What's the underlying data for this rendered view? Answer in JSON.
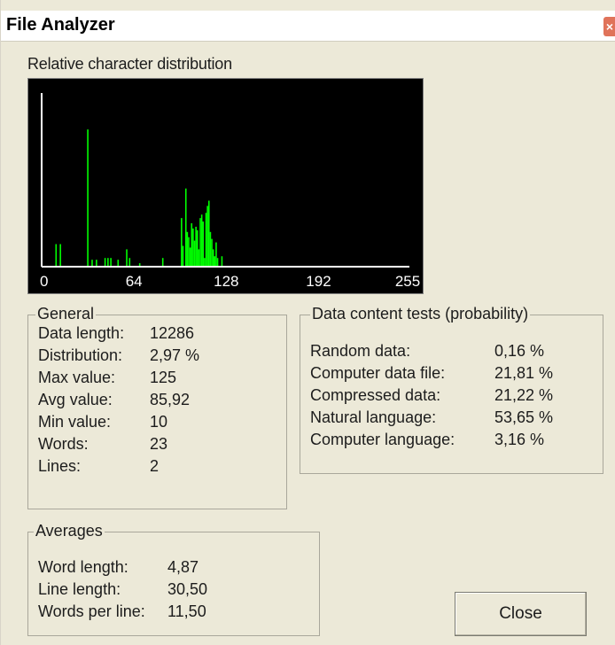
{
  "window": {
    "title": "File Analyzer",
    "close_glyph": "×"
  },
  "histogram": {
    "label": "Relative character distribution",
    "tick_labels": [
      "0",
      "64",
      "128",
      "192",
      "255"
    ],
    "colors": {
      "background": "#000000",
      "bars": "#00ff00",
      "axis": "#ffffff"
    },
    "chart_data": {
      "type": "bar",
      "x_range": [
        0,
        255
      ],
      "ylim": [
        0,
        1
      ],
      "points": [
        {
          "x": 10,
          "v": 0.13
        },
        {
          "x": 13,
          "v": 0.13
        },
        {
          "x": 32,
          "v": 0.79
        },
        {
          "x": 35,
          "v": 0.04
        },
        {
          "x": 38,
          "v": 0.04
        },
        {
          "x": 44,
          "v": 0.05
        },
        {
          "x": 46,
          "v": 0.05
        },
        {
          "x": 48,
          "v": 0.05
        },
        {
          "x": 53,
          "v": 0.04
        },
        {
          "x": 59,
          "v": 0.1
        },
        {
          "x": 61,
          "v": 0.05
        },
        {
          "x": 68,
          "v": 0.02
        },
        {
          "x": 84,
          "v": 0.05
        },
        {
          "x": 97,
          "v": 0.28
        },
        {
          "x": 98,
          "v": 0.12
        },
        {
          "x": 100,
          "v": 0.45
        },
        {
          "x": 101,
          "v": 0.2
        },
        {
          "x": 102,
          "v": 0.17
        },
        {
          "x": 103,
          "v": 0.11
        },
        {
          "x": 104,
          "v": 0.25
        },
        {
          "x": 105,
          "v": 0.22
        },
        {
          "x": 106,
          "v": 0.15
        },
        {
          "x": 107,
          "v": 0.23
        },
        {
          "x": 108,
          "v": 0.21
        },
        {
          "x": 109,
          "v": 0.1
        },
        {
          "x": 110,
          "v": 0.28
        },
        {
          "x": 111,
          "v": 0.3
        },
        {
          "x": 112,
          "v": 0.26
        },
        {
          "x": 113,
          "v": 0.05
        },
        {
          "x": 114,
          "v": 0.31
        },
        {
          "x": 115,
          "v": 0.35
        },
        {
          "x": 116,
          "v": 0.38
        },
        {
          "x": 117,
          "v": 0.2
        },
        {
          "x": 118,
          "v": 0.16
        },
        {
          "x": 119,
          "v": 0.1
        },
        {
          "x": 120,
          "v": 0.06
        },
        {
          "x": 121,
          "v": 0.14
        },
        {
          "x": 122,
          "v": 0.05
        },
        {
          "x": 125,
          "v": 0.06
        }
      ]
    }
  },
  "general": {
    "title": "General",
    "rows": [
      {
        "label": "Data length:",
        "value": "12286"
      },
      {
        "label": "Distribution:",
        "value": "2,97 %"
      },
      {
        "label": "Max value:",
        "value": "125"
      },
      {
        "label": "Avg value:",
        "value": "85,92"
      },
      {
        "label": "Min value:",
        "value": "10"
      },
      {
        "label": "Words:",
        "value": "23"
      },
      {
        "label": "Lines:",
        "value": "2"
      }
    ]
  },
  "tests": {
    "title": "Data content tests (probability)",
    "rows": [
      {
        "label": "Random data:",
        "value": "0,16 %"
      },
      {
        "label": "Computer data file:",
        "value": "21,81 %"
      },
      {
        "label": "Compressed data:",
        "value": "21,22 %"
      },
      {
        "label": "Natural language:",
        "value": "53,65 %"
      },
      {
        "label": "Computer language:",
        "value": "3,16 %"
      }
    ]
  },
  "averages": {
    "title": "Averages",
    "rows": [
      {
        "label": "Word length:",
        "value": "4,87"
      },
      {
        "label": "Line length:",
        "value": "30,50"
      },
      {
        "label": "Words per line:",
        "value": "11,50"
      }
    ]
  },
  "buttons": {
    "close_label": "Close"
  }
}
